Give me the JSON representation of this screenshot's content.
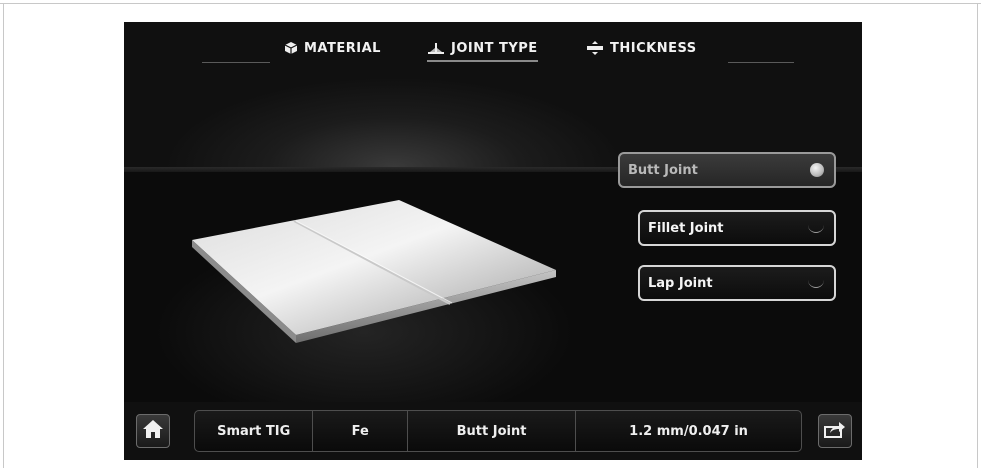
{
  "tabs": [
    {
      "label": "MATERIAL",
      "icon": "cube-icon",
      "active": false
    },
    {
      "label": "JOINT TYPE",
      "icon": "joint-icon",
      "active": true
    },
    {
      "label": "THICKNESS",
      "icon": "thickness-icon",
      "active": false
    }
  ],
  "options": [
    {
      "label": "Butt Joint",
      "selected": true
    },
    {
      "label": "Fillet Joint",
      "selected": false
    },
    {
      "label": "Lap Joint",
      "selected": false
    }
  ],
  "status": {
    "process": "Smart TIG",
    "material": "Fe",
    "joint": "Butt Joint",
    "thickness": "1.2 mm/0.047 in"
  },
  "icons": {
    "home": "home-icon",
    "share": "share-icon"
  },
  "colors": {
    "background": "#111111",
    "text": "#f2f2f2",
    "border": "#d6d6d6"
  }
}
